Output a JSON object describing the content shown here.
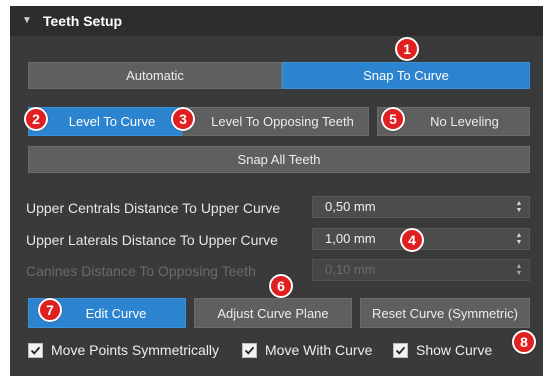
{
  "header": {
    "title": "Teeth Setup"
  },
  "mode_buttons": {
    "automatic": "Automatic",
    "snap_to_curve": "Snap To Curve"
  },
  "level_buttons": {
    "level_to_curve": "Level To Curve",
    "level_to_opposing": "Level To Opposing Teeth",
    "no_leveling": "No Leveling"
  },
  "snap_all": "Snap All Teeth",
  "distances": [
    {
      "label": "Upper Centrals Distance To Upper Curve",
      "value": "0,50 mm",
      "enabled": true
    },
    {
      "label": "Upper Laterals Distance To Upper Curve",
      "value": "1,00 mm",
      "enabled": true
    },
    {
      "label": "Canines Distance To Opposing Teeth",
      "value": "0,10 mm",
      "enabled": false
    }
  ],
  "curve_buttons": {
    "edit": "Edit Curve",
    "adjust": "Adjust Curve Plane",
    "reset": "Reset Curve (Symmetric)"
  },
  "checkboxes": [
    {
      "label": "Move Points Symmetrically",
      "checked": true
    },
    {
      "label": "Move With Curve",
      "checked": true
    },
    {
      "label": "Show Curve",
      "checked": true
    }
  ],
  "markers": [
    "1",
    "2",
    "3",
    "4",
    "5",
    "6",
    "7",
    "8"
  ],
  "colors": {
    "accent": "#2c84d0",
    "marker": "#e02020",
    "panel": "#3a3a3a"
  }
}
